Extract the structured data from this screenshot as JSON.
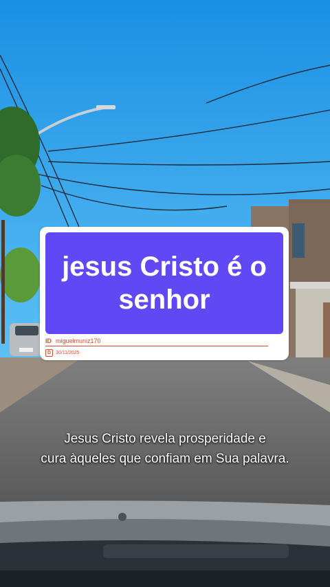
{
  "card": {
    "title": "jesus Cristo é o senhor",
    "id_label": "ID",
    "id_value": "miguelmuniz170",
    "date_icon": "D",
    "date": "30/11/2025"
  },
  "subtitle": {
    "line1": "Jesus Cristo revela prosperidade e",
    "line2": "cura àqueles que confiam em Sua palavra."
  }
}
